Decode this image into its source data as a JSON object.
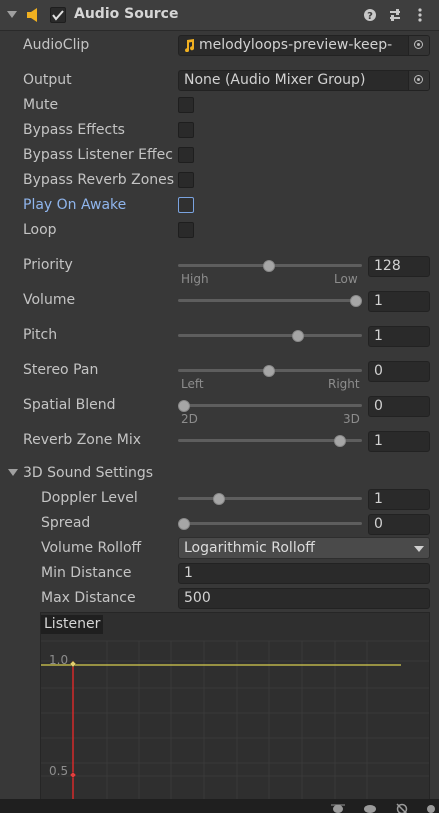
{
  "header": {
    "title": "Audio Source",
    "enabled": true,
    "icons": [
      "chevron-down-icon",
      "speaker-icon",
      "help-icon",
      "preset-icon",
      "more-vert-icon"
    ]
  },
  "audioclip": {
    "label": "AudioClip",
    "value": "melodyloops-preview-keep-",
    "icon": "music-note-icon"
  },
  "output": {
    "label": "Output",
    "value": "None (Audio Mixer Group)"
  },
  "toggles": [
    {
      "label": "Mute",
      "checked": false
    },
    {
      "label": "Bypass Effects",
      "checked": false
    },
    {
      "label": "Bypass Listener Effec",
      "checked": false
    },
    {
      "label": "Bypass Reverb Zones",
      "checked": false
    },
    {
      "label": "Play On Awake",
      "checked": false
    },
    {
      "label": "Loop",
      "checked": false
    }
  ],
  "sliders": {
    "priority": {
      "label": "Priority",
      "value": "128",
      "fraction": 0.5,
      "left_hint": "High",
      "right_hint": "Low"
    },
    "volume": {
      "label": "Volume",
      "value": "1",
      "fraction": 1.0
    },
    "pitch": {
      "label": "Pitch",
      "value": "1",
      "fraction": 0.66
    },
    "stereo_pan": {
      "label": "Stereo Pan",
      "value": "0",
      "fraction": 0.5,
      "left_hint": "Left",
      "right_hint": "Right"
    },
    "spatial_blend": {
      "label": "Spatial Blend",
      "value": "0",
      "fraction": 0.0,
      "left_hint": "2D",
      "right_hint": "3D"
    },
    "reverb_zone_mix": {
      "label": "Reverb Zone Mix",
      "value": "1",
      "fraction": 0.88
    }
  },
  "sound3d": {
    "label": "3D Sound Settings",
    "doppler": {
      "label": "Doppler Level",
      "value": "1",
      "fraction": 0.2
    },
    "spread": {
      "label": "Spread",
      "value": "0",
      "fraction": 0.0
    },
    "rolloff": {
      "label": "Volume Rolloff",
      "value": "Logarithmic Rolloff"
    },
    "min_distance": {
      "label": "Min Distance",
      "value": "1"
    },
    "max_distance": {
      "label": "Max Distance",
      "value": "500"
    }
  },
  "graph": {
    "title": "Listener",
    "tick_top": "1.0",
    "tick_mid": "0.5"
  },
  "colors": {
    "accent": "#8fb5ec",
    "curve": "#bcb34a",
    "listener_line": "#d42a2a",
    "speaker_icon": "#f0b020"
  }
}
